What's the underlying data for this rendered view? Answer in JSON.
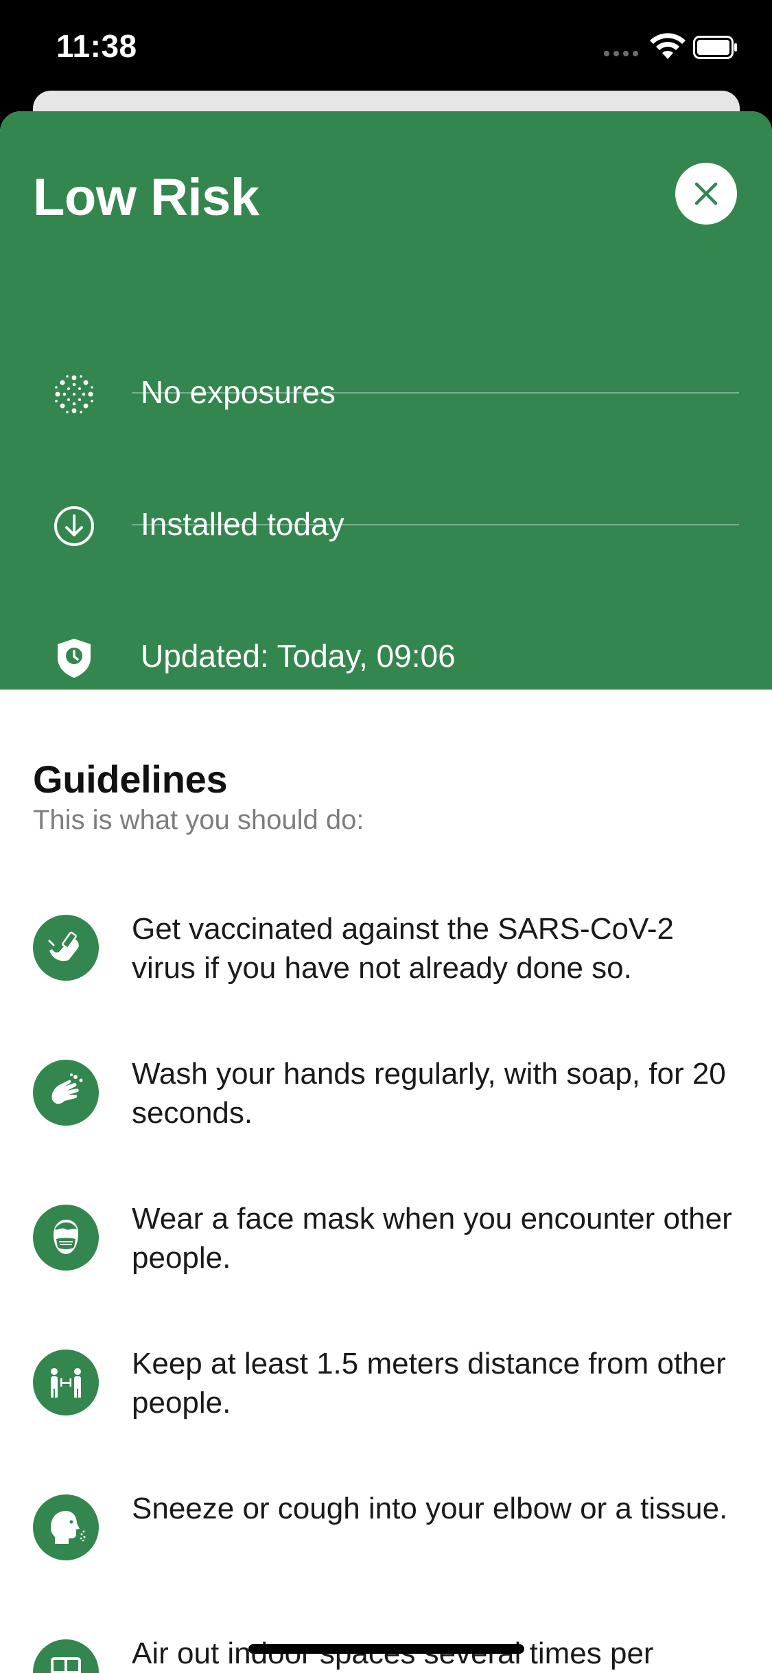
{
  "status_bar": {
    "time": "11:38"
  },
  "risk": {
    "title": "Low Risk",
    "background_color": "#34864f",
    "rows": [
      {
        "icon": "virus-icon",
        "text": "No exposures"
      },
      {
        "icon": "download-circle-icon",
        "text": "Installed today"
      },
      {
        "icon": "shield-clock-icon",
        "text": "Updated: Today, 09:06"
      }
    ]
  },
  "guidelines": {
    "title": "Guidelines",
    "subtitle": "This is what you should do:",
    "items": [
      {
        "icon": "vaccine-arm-icon",
        "text": "Get vaccinated against the SARS-CoV-2 virus if you have not already done so."
      },
      {
        "icon": "wash-hands-icon",
        "text": "Wash your hands regularly, with soap, for 20 seconds."
      },
      {
        "icon": "face-mask-icon",
        "text": "Wear a face mask when you encounter other people."
      },
      {
        "icon": "distance-icon",
        "text": "Keep at least 1.5 meters distance from other people."
      },
      {
        "icon": "sneeze-icon",
        "text": "Sneeze or cough into your elbow or a tissue."
      },
      {
        "icon": "ventilate-icon",
        "text": "Air out indoor spaces several times per"
      }
    ]
  }
}
